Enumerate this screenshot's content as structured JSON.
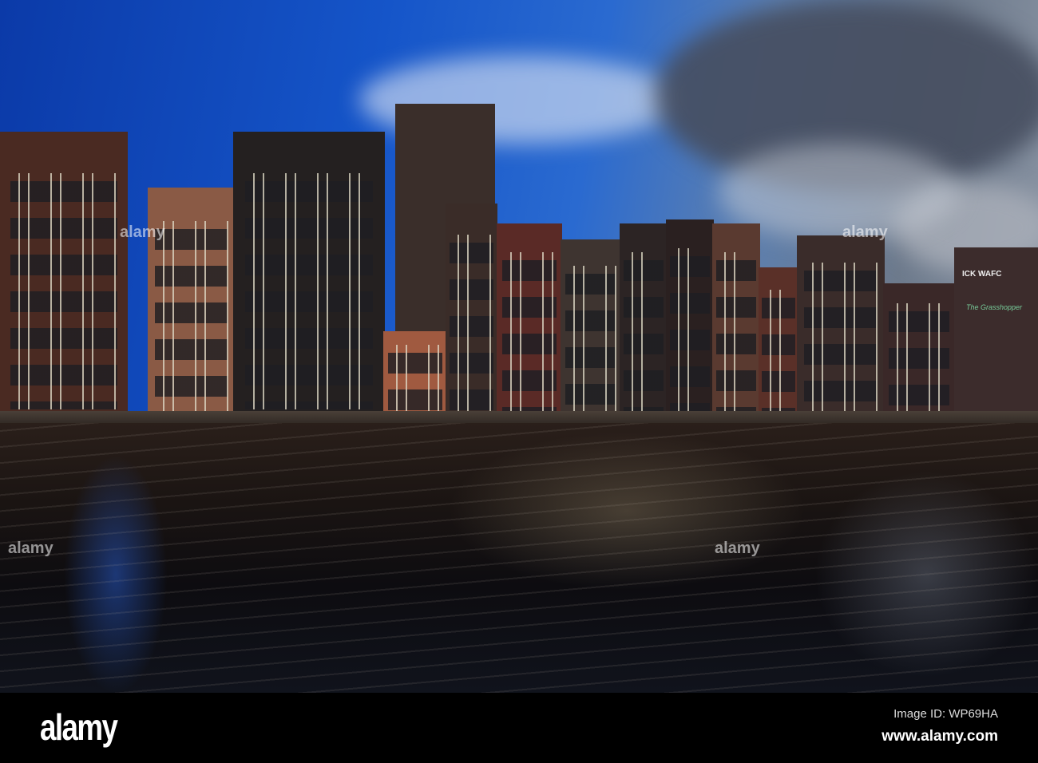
{
  "photo": {
    "subject": "canal houses",
    "colors": {
      "sky": "#1555c9",
      "water": "#1a1412",
      "footer": "#000000"
    }
  },
  "signs": {
    "shop_sign": "ICK WAFC",
    "script_sign": "The Grasshopper"
  },
  "watermark": {
    "text": "alamy"
  },
  "footer": {
    "logo": "alamy",
    "image_id": "Image ID: WP69HA",
    "website": "www.alamy.com"
  }
}
